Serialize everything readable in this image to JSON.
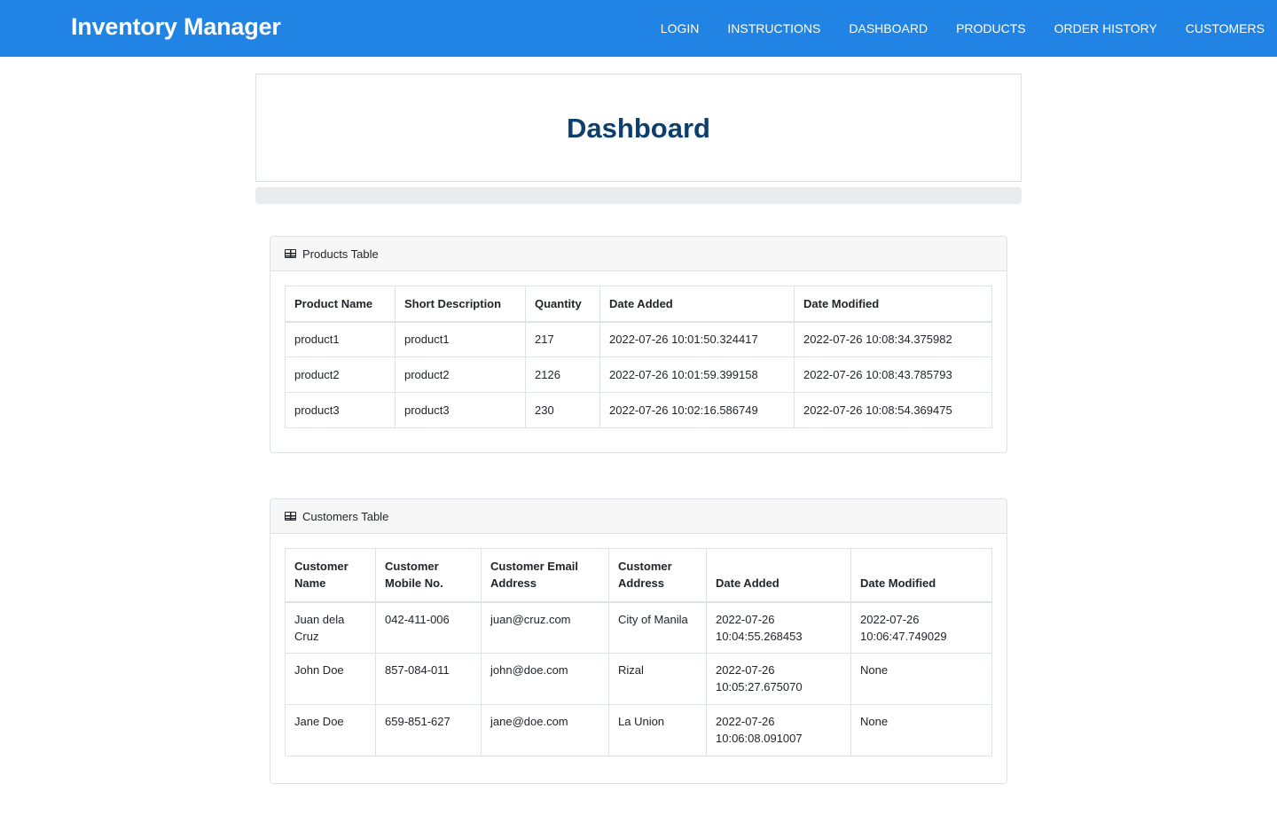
{
  "app": {
    "brand": "Inventory Manager"
  },
  "nav": {
    "items": [
      "LOGIN",
      "INSTRUCTIONS",
      "DASHBOARD",
      "PRODUCTS",
      "ORDER HISTORY",
      "CUSTOMERS"
    ]
  },
  "page": {
    "title": "Dashboard"
  },
  "products_table": {
    "title": "Products Table",
    "icon": "table-icon",
    "headers": [
      "Product Name",
      "Short Description",
      "Quantity",
      "Date Added",
      "Date Modified"
    ],
    "rows": [
      [
        "product1",
        "product1",
        "217",
        "2022-07-26 10:01:50.324417",
        "2022-07-26 10:08:34.375982"
      ],
      [
        "product2",
        "product2",
        "2126",
        "2022-07-26 10:01:59.399158",
        "2022-07-26 10:08:43.785793"
      ],
      [
        "product3",
        "product3",
        "230",
        "2022-07-26 10:02:16.586749",
        "2022-07-26 10:08:54.369475"
      ]
    ]
  },
  "customers_table": {
    "title": "Customers Table",
    "icon": "table-icon",
    "headers": [
      "Customer Name",
      "Customer Mobile No.",
      "Customer Email Address",
      "Customer Address",
      "Date Added",
      "Date Modified"
    ],
    "rows": [
      [
        "Juan dela Cruz",
        "042-411-006",
        "juan@cruz.com",
        "City of Manila",
        "2022-07-26 10:04:55.268453",
        "2022-07-26 10:06:47.749029"
      ],
      [
        "John Doe",
        "857-084-011",
        "john@doe.com",
        "Rizal",
        "2022-07-26 10:05:27.675070",
        "None"
      ],
      [
        "Jane Doe",
        "659-851-627",
        "jane@doe.com",
        "La Union",
        "2022-07-26 10:06:08.091007",
        "None"
      ]
    ]
  },
  "colors": {
    "navbar": "#2183e3",
    "title": "#0d3f6e"
  }
}
